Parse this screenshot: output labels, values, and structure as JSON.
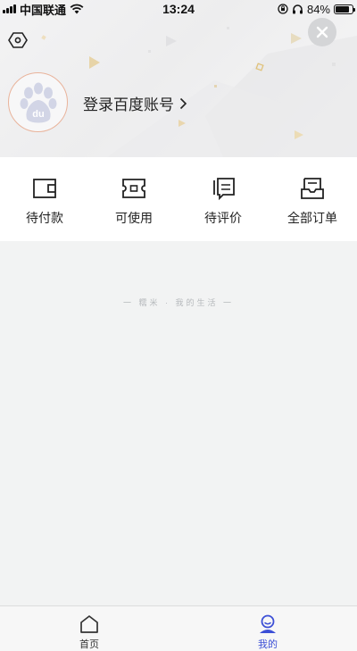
{
  "status_bar": {
    "carrier": "中国联通",
    "time": "13:24",
    "battery_percent": "84%",
    "battery_level": 0.84
  },
  "header": {
    "login_text": "登录百度账号",
    "avatar_logo_text": "du"
  },
  "orders": [
    {
      "label": "待付款",
      "icon": "wallet-icon"
    },
    {
      "label": "可使用",
      "icon": "ticket-icon"
    },
    {
      "label": "待评价",
      "icon": "comment-icon"
    },
    {
      "label": "全部订单",
      "icon": "order-list-icon"
    }
  ],
  "tagline": "一 糯米 · 我的生活 一",
  "tab_bar": {
    "items": [
      {
        "label": "首页",
        "icon": "home-icon",
        "active": false
      },
      {
        "label": "我的",
        "icon": "profile-icon",
        "active": true
      }
    ]
  },
  "colors": {
    "accent": "#3c4fd6",
    "avatar_border": "#e9b39b",
    "baidu_paw": "#d2d5e6"
  }
}
